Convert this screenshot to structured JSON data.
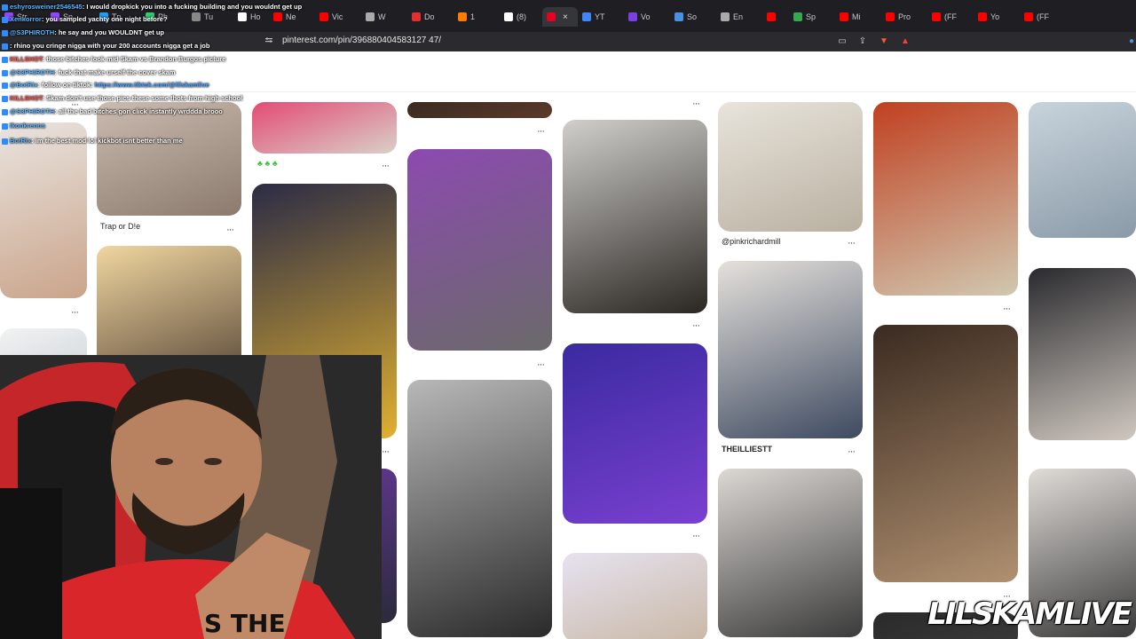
{
  "browser": {
    "tabs": [
      {
        "label": "Str",
        "color": "#9146ff"
      },
      {
        "label": "Sn",
        "color": "#9146ff"
      },
      {
        "label": "Tp",
        "color": "#1da1f2"
      },
      {
        "label": "Ph",
        "color": "#2ecc71"
      },
      {
        "label": "Tu",
        "color": "#888888"
      },
      {
        "label": "Ho",
        "color": "#ffffff"
      },
      {
        "label": "Ne",
        "color": "#ff0000"
      },
      {
        "label": "Vic",
        "color": "#ff0000"
      },
      {
        "label": "W",
        "color": "#aaaaaa"
      },
      {
        "label": "Do",
        "color": "#e03030"
      },
      {
        "label": "1",
        "color": "#ff7a00"
      },
      {
        "label": "(8)",
        "color": "#ffffff"
      },
      {
        "label": "",
        "color": "#e60023"
      },
      {
        "label": "YT",
        "color": "#4285f4"
      },
      {
        "label": "Vo",
        "color": "#7b3fe4"
      },
      {
        "label": "So",
        "color": "#4a90e2"
      },
      {
        "label": "En",
        "color": "#aaaaaa"
      },
      {
        "label": "",
        "color": "#ff0000"
      },
      {
        "label": "Sp",
        "color": "#34a853"
      },
      {
        "label": "Mi",
        "color": "#ff0000"
      },
      {
        "label": "Pro",
        "color": "#ff0000"
      },
      {
        "label": "(FF",
        "color": "#ff0000"
      },
      {
        "label": "Yo",
        "color": "#ff0000"
      },
      {
        "label": "(FF",
        "color": "#ff0000"
      }
    ],
    "active_tab_close": "×",
    "url": "pinterest.com/pin/396880404583127 47/"
  },
  "chat": {
    "messages": [
      {
        "user": "eshyrosweiner2546545",
        "text": ": I would dropkick you into a fucking building and you wouldnt get up",
        "user_color": "b"
      },
      {
        "user": "Xenkorror",
        "text": ": you sampled yachty one night before?",
        "user_color": "b"
      },
      {
        "user": "@S3PHIROTH",
        "text": ": he say and you WOULDNT get up",
        "user_color": "b"
      },
      {
        "user": "",
        "text": ": rhino you cringe nigga with your 200 accounts nigga get a job",
        "user_color": "r"
      },
      {
        "user": "KILLSHOT",
        "text": ": those bitches look mid Skam vs Brandon Burgos picture",
        "user_color": "r"
      },
      {
        "user": "@S3PHIROTH",
        "text": ": fuck that make urself the cover skam",
        "user_color": "b"
      },
      {
        "user": "@BotRix",
        "text": ": follow on tiktok: ",
        "link": "https://www.tiktok.com/@lilskamlive",
        "user_color": "b"
      },
      {
        "user": "KILLSHOT",
        "text": ": Skam don't use those pics these some thots from high school",
        "user_color": "r"
      },
      {
        "user": "@S3PHIROTH",
        "text": ": all the bad bitches gon click instantly wrddda brooo",
        "user_color": "b"
      },
      {
        "user": "ikonkrenns",
        "text": "",
        "user_color": "b"
      },
      {
        "user": "BotRix",
        "text": ": im the best mod lol kickbot isnt better than me",
        "user_color": "b"
      }
    ]
  },
  "pins": {
    "labels": {
      "trap_or_die": "Trap or D!e",
      "pinkrichardmill": "@pinkrichardmill",
      "theillestt": "THEILLIESTT"
    },
    "dots": "···"
  },
  "stream": {
    "watermark": "LILSKAMLIVE"
  }
}
